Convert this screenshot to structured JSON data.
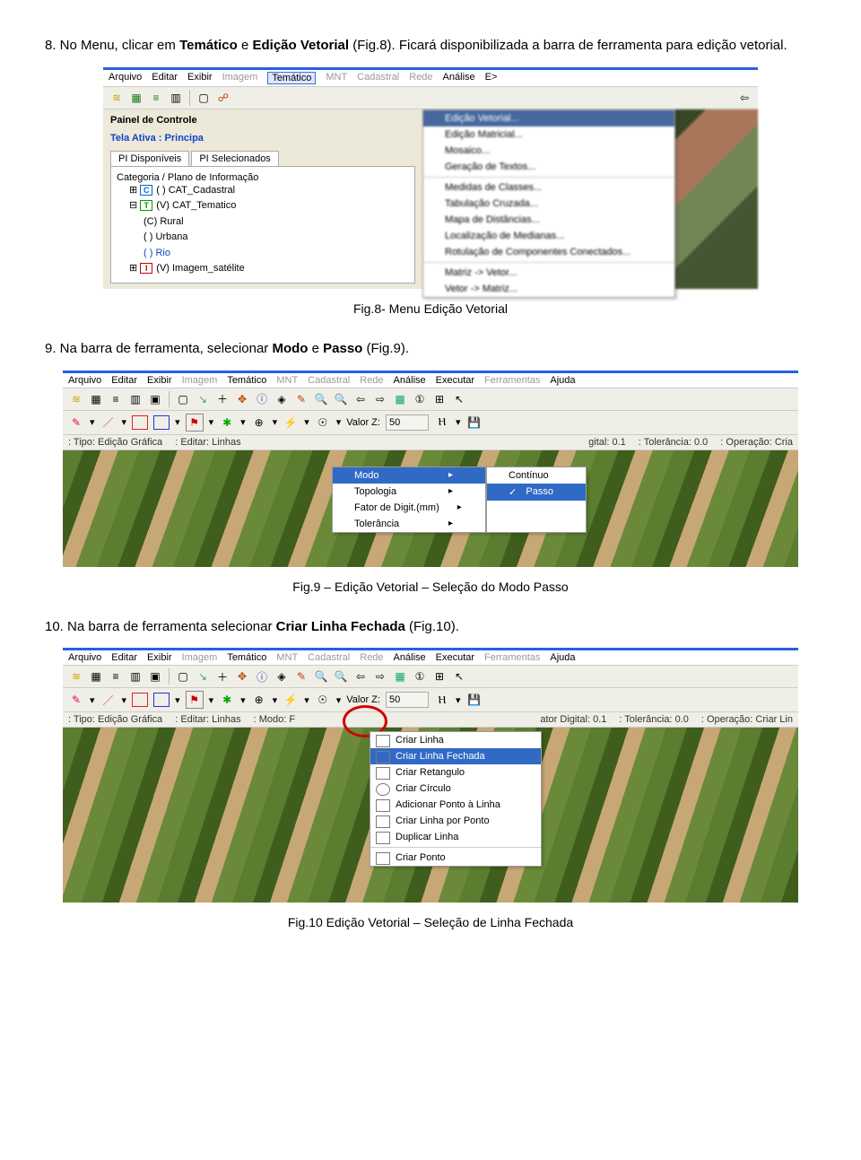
{
  "p8": {
    "pre": "8. No Menu, clicar em ",
    "b1": "Temático",
    "mid": " e ",
    "b2": "Edição Vetorial",
    "post": " (Fig.8). Ficará disponibilizada a barra de ferramenta para edição vetorial."
  },
  "shot1": {
    "menus": {
      "arquivo": "Arquivo",
      "editar": "Editar",
      "exibir": "Exibir",
      "imagem": "Imagem",
      "tematico": "Temático",
      "mnt": "MNT",
      "cadastral": "Cadastral",
      "rede": "Rede",
      "analise": "Análise",
      "ex": "E>"
    },
    "panel_title": "Painel de Controle",
    "tela": "Tela Ativa : Principa",
    "tabs": {
      "disp": "PI Disponíveis",
      "sel": "PI Selecionados"
    },
    "cat_label": "Categoria / Plano de Informação",
    "tree": {
      "cad": "( ) CAT_Cadastral",
      "tem": "(V) CAT_Tematico",
      "rural": "(C) Rural",
      "urbana": "( ) Urbana",
      "rio": "( ) Rio",
      "img": "(V) Imagem_satélite"
    },
    "dd": {
      "ed_vet": "Edição Vetorial...",
      "ed_mat": "Edição Matricial...",
      "mosaico": "Mosaico...",
      "gertex": "Geração de Textos...",
      "medidas": "Medidas de Classes...",
      "tabcruz": "Tabulação Cruzada...",
      "mapadist": "Mapa de Distâncias...",
      "locmed": "Localização de Medianas...",
      "rotcomp": "Rotulação de Componentes Conectados...",
      "mvet": "Matriz -> Vetor...",
      "vmat": "Vetor -> Matriz..."
    }
  },
  "cap8": "Fig.8- Menu Edição Vetorial",
  "p9": {
    "pre": "9. Na barra de ferramenta, selecionar ",
    "b1": "Modo",
    "mid": " e ",
    "b2": "Passo",
    "post": " (Fig.9)."
  },
  "shot2": {
    "menus": {
      "arquivo": "Arquivo",
      "editar": "Editar",
      "exibir": "Exibir",
      "imagem": "Imagem",
      "tematico": "Temático",
      "mnt": "MNT",
      "cadastral": "Cadastral",
      "rede": "Rede",
      "analise": "Análise",
      "exec": "Executar",
      "ferr": "Ferramentas",
      "ajuda": "Ajuda"
    },
    "valorz_label": "Valor Z:",
    "valorz": "50",
    "info": {
      "tipo_l": "Tipo:",
      "tipo": "Edição Gráfica",
      "editar_l": "Editar:",
      "editar": "Linhas",
      "gital_l": "gital:",
      "gital": "0.1",
      "tol_l": "Tolerância:",
      "tol": "0.0",
      "op_l": "Operação:",
      "op": "Cria"
    },
    "dd": {
      "modo": "Modo",
      "topo": "Topologia",
      "fator": "Fator de Digit.(mm)",
      "tol": "Tolerância"
    },
    "sub": {
      "cont": "Contínuo",
      "passo": "Passo"
    }
  },
  "cap9": "Fig.9 – Edição Vetorial – Seleção do Modo Passo",
  "p10": {
    "pre": "10. Na barra de ferramenta selecionar ",
    "b1": "Criar Linha Fechada",
    "post": " (Fig.10)."
  },
  "shot3": {
    "info": {
      "tipo_l": "Tipo:",
      "tipo": "Edição Gráfica",
      "editar_l": "Editar:",
      "editar": "Linhas",
      "modo_l": "Modo:",
      "modo": "F",
      "ator_l": "ator Digital:",
      "ator": "0.1",
      "tol_l": "Tolerância:",
      "tol": "0.0",
      "op_l": "Operação:",
      "op": "Criar Lin"
    },
    "dd": {
      "clinha": "Criar Linha",
      "cfechada": "Criar Linha Fechada",
      "cret": "Criar Retangulo",
      "ccirc": "Criar Círculo",
      "addp": "Adicionar Ponto à Linha",
      "clpp": "Criar Linha por Ponto",
      "dup": "Duplicar Linha",
      "cponto": "Criar Ponto"
    }
  },
  "cap10": "Fig.10 Edição Vetorial – Seleção de Linha Fechada"
}
